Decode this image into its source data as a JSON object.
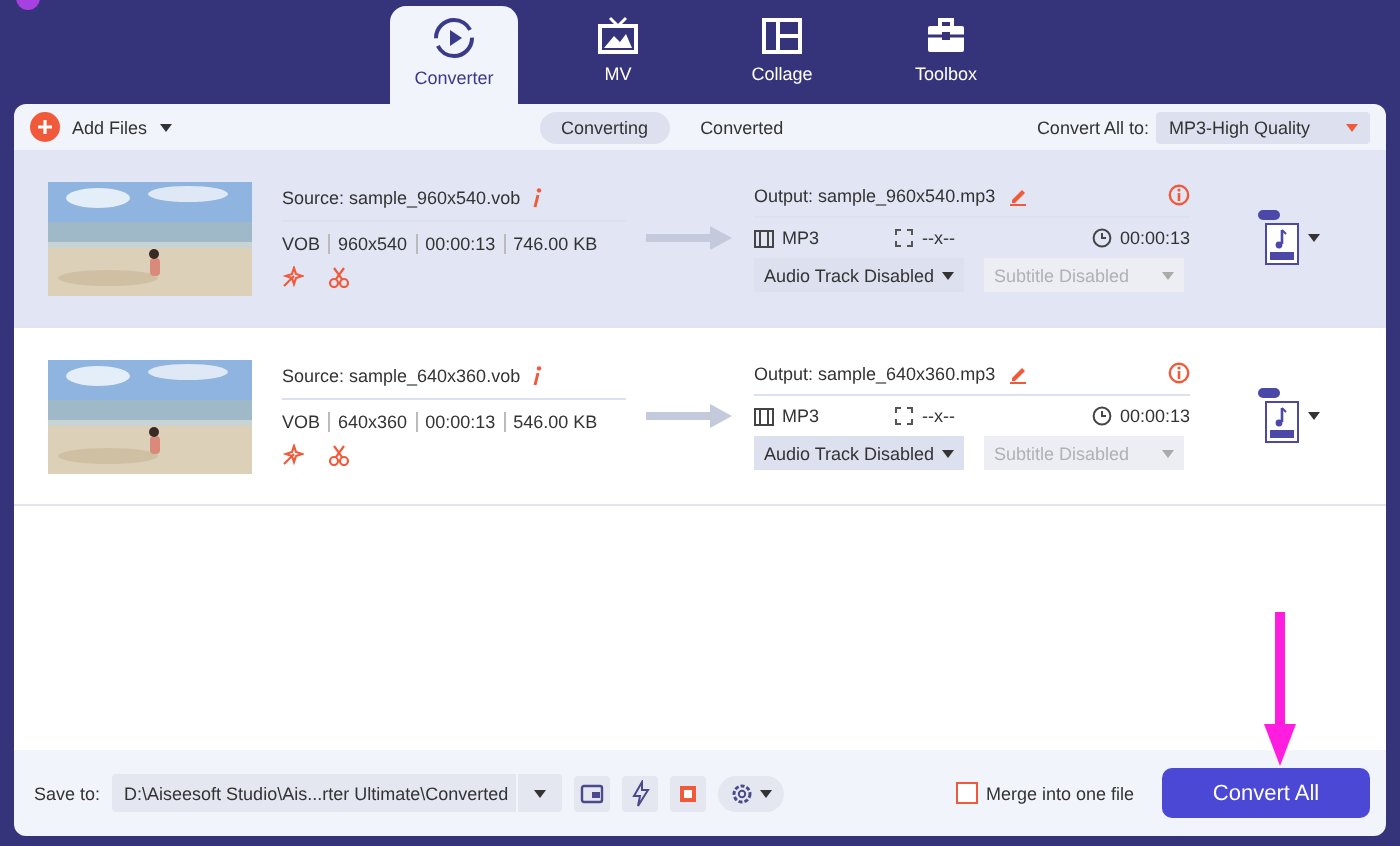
{
  "tabs": [
    {
      "label": "Converter",
      "kind": "converter",
      "selected": true
    },
    {
      "label": "MV",
      "kind": "mv",
      "selected": false
    },
    {
      "label": "Collage",
      "kind": "collage",
      "selected": false
    },
    {
      "label": "Toolbox",
      "kind": "toolbox",
      "selected": false
    }
  ],
  "toolbar": {
    "add_files": "Add Files",
    "subtabs": [
      {
        "label": "Converting",
        "selected": true
      },
      {
        "label": "Converted",
        "selected": false
      }
    ],
    "convert_all_label": "Convert All to:",
    "convert_all_value": "MP3-High Quality"
  },
  "files": [
    {
      "selected": true,
      "source": "Source: sample_960x540.vob",
      "format": "VOB",
      "resolution": "960x540",
      "duration": "00:00:13",
      "size": "746.00 KB",
      "output": "Output: sample_960x540.mp3",
      "out_format": "MP3",
      "out_resolution": "--x--",
      "out_duration": "00:00:13",
      "audio_track": "Audio Track Disabled",
      "subtitle": "Subtitle Disabled",
      "subtitle_disabled": true
    },
    {
      "selected": false,
      "source": "Source: sample_640x360.vob",
      "format": "VOB",
      "resolution": "640x360",
      "duration": "00:00:13",
      "size": "546.00 KB",
      "output": "Output: sample_640x360.mp3",
      "out_format": "MP3",
      "out_resolution": "--x--",
      "out_duration": "00:00:13",
      "audio_track": "Audio Track Disabled",
      "subtitle": "Subtitle Disabled",
      "subtitle_disabled": true
    }
  ],
  "bottom": {
    "save_to_label": "Save to:",
    "save_path": "D:\\Aiseesoft Studio\\Ais...rter Ultimate\\Converted",
    "merge_label": "Merge into one file",
    "merge_checked": false,
    "convert_button": "Convert All"
  }
}
